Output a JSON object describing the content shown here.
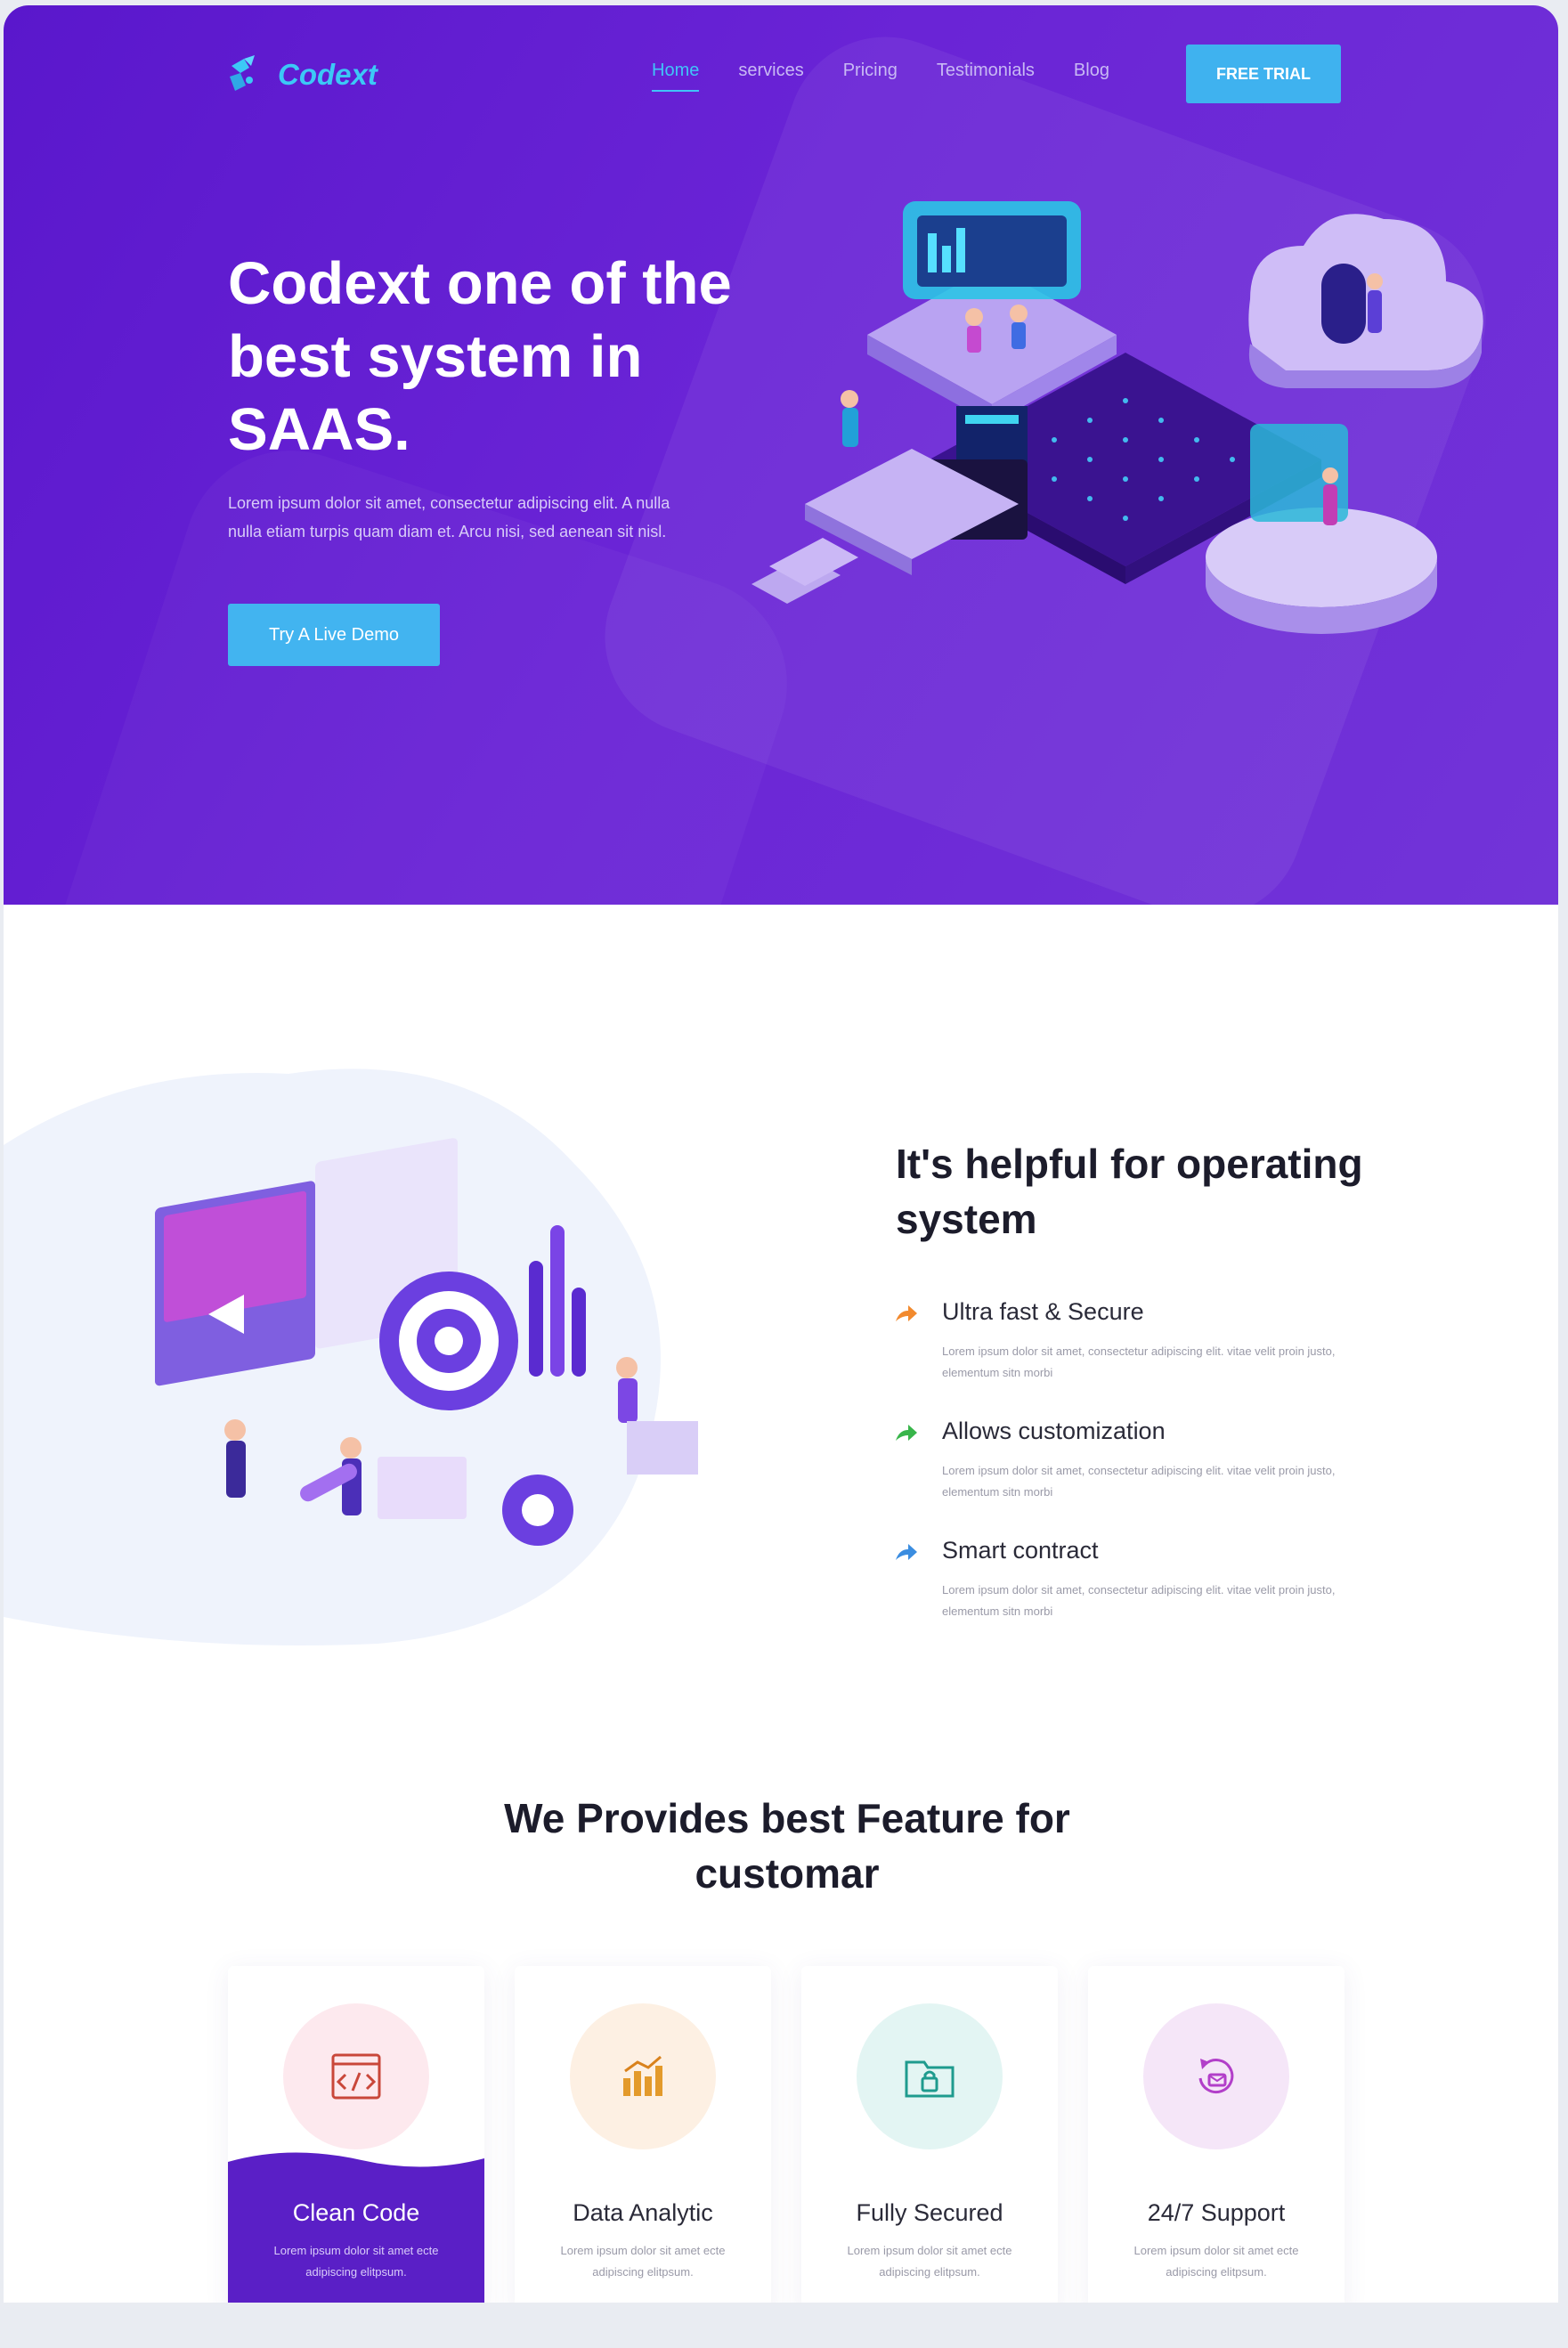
{
  "brand": {
    "name": "Codext",
    "accent": "#3cc8f6",
    "primary": "#5a17cc"
  },
  "nav": {
    "items": [
      {
        "label": "Home",
        "active": true
      },
      {
        "label": "services"
      },
      {
        "label": "Pricing"
      },
      {
        "label": "Testimonials"
      },
      {
        "label": "Blog"
      }
    ],
    "cta": "FREE TRIAL"
  },
  "hero": {
    "title": "Codext one of the best system in SAAS.",
    "description": "Lorem ipsum dolor sit amet, consectetur adipiscing elit. A nulla nulla etiam turpis quam diam et. Arcu nisi, sed aenean sit nisl.",
    "button": "Try A Live Demo"
  },
  "about": {
    "title": "It's helpful for operating system",
    "features": [
      {
        "title": "Ultra fast & Secure",
        "description": "Lorem ipsum dolor sit amet, consectetur adipiscing elit. vitae velit proin justo, elementum sitn morbi",
        "icon": "arrow-icon",
        "color": "#f28a2e"
      },
      {
        "title": "Allows customization",
        "description": "Lorem ipsum dolor sit amet, consectetur adipiscing elit. vitae velit proin justo, elementum sitn morbi",
        "icon": "arrow-icon",
        "color": "#38b54a"
      },
      {
        "title": "Smart contract",
        "description": "Lorem ipsum dolor sit amet, consectetur adipiscing elit. vitae velit proin justo, elementum sitn morbi",
        "icon": "arrow-icon",
        "color": "#3b8de0"
      }
    ]
  },
  "services": {
    "title": "We Provides best Feature for customar",
    "cards": [
      {
        "title": "Clean Code",
        "description": "Lorem ipsum dolor sit amet ecte adipiscing elitpsum.",
        "icon": "code-icon",
        "circle": "#fde9ee",
        "active": true
      },
      {
        "title": "Data Analytic",
        "description": "Lorem ipsum dolor sit amet ecte adipiscing elitpsum.",
        "icon": "bar-chart-icon",
        "circle": "#fdf0e3"
      },
      {
        "title": "Fully Secured",
        "description": "Lorem ipsum dolor sit amet ecte adipiscing elitpsum.",
        "icon": "lock-folder-icon",
        "circle": "#e3f5f3"
      },
      {
        "title": "24/7 Support",
        "description": "Lorem ipsum dolor sit amet ecte adipiscing elitpsum.",
        "icon": "support-icon",
        "circle": "#f5e6f8"
      }
    ]
  }
}
